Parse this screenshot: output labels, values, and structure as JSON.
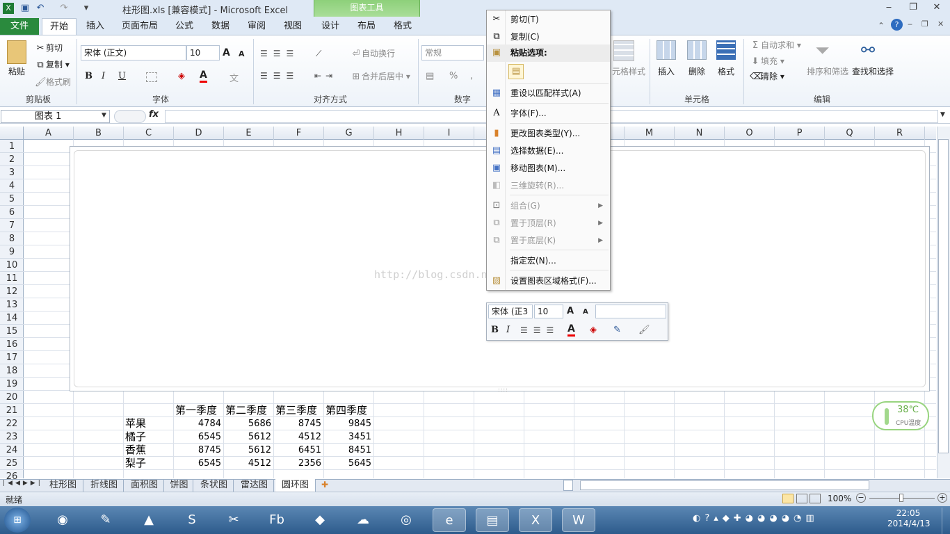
{
  "titlebar": {
    "title": "柱形图.xls  [兼容模式] - Microsoft Excel",
    "context_tools": "图表工具",
    "minimize": "‒",
    "restore": "❐",
    "close": "✕"
  },
  "tabs": [
    "文件",
    "开始",
    "插入",
    "页面布局",
    "公式",
    "数据",
    "审阅",
    "视图",
    "设计",
    "布局",
    "格式"
  ],
  "ribbon": {
    "clipboard": {
      "paste": "粘贴",
      "cut": "剪切",
      "copy": "复制",
      "format_painter": "格式刷",
      "label": "剪贴板"
    },
    "font": {
      "name": "宋体 (正文)",
      "size": "10",
      "bold": "B",
      "italic": "I",
      "underline": "U",
      "label": "字体",
      "grow": "A",
      "shrink": "A"
    },
    "alignment": {
      "wrap": "自动换行",
      "merge": "合并后居中",
      "label": "对齐方式"
    },
    "number": {
      "format": "常规",
      "percent": "%",
      "comma": ",",
      "label": "数字"
    },
    "styles": {
      "cell_styles": "元格样式"
    },
    "cells": {
      "insert": "插入",
      "delete": "删除",
      "format": "格式",
      "label": "单元格"
    },
    "editing": {
      "autosum": "自动求和",
      "fill": "填充",
      "clear": "清除",
      "sort": "排序和筛选",
      "find": "查找和选择",
      "label": "编辑"
    }
  },
  "formula_bar": {
    "name_box": "图表 1",
    "fx": "fx",
    "value": ""
  },
  "columns": [
    "A",
    "B",
    "C",
    "D",
    "E",
    "F",
    "G",
    "H",
    "I",
    "J",
    "K",
    "L",
    "M",
    "N",
    "O",
    "P",
    "Q",
    "R"
  ],
  "rows": [
    "1",
    "2",
    "3",
    "4",
    "5",
    "6",
    "7",
    "8",
    "9",
    "10",
    "11",
    "12",
    "13",
    "14",
    "15",
    "16",
    "17",
    "18",
    "19",
    "20",
    "21",
    "22",
    "23",
    "24",
    "25",
    "26"
  ],
  "table": {
    "headers": [
      "第一季度",
      "第二季度",
      "第三季度",
      "第四季度"
    ],
    "rows": [
      {
        "label": "苹果",
        "values": [
          "4784",
          "5686",
          "8745",
          "9845"
        ]
      },
      {
        "label": "橘子",
        "values": [
          "6545",
          "5612",
          "4512",
          "3451"
        ]
      },
      {
        "label": "香蕉",
        "values": [
          "8745",
          "5612",
          "6451",
          "8451"
        ]
      },
      {
        "label": "梨子",
        "values": [
          "6545",
          "4512",
          "2356",
          "5645"
        ]
      }
    ]
  },
  "watermark": "http://blog.csdn.net/xiaobai45",
  "context_menu": {
    "cut": "剪切(T)",
    "copy": "复制(C)",
    "paste_options": "粘贴选项:",
    "reset_style": "重设以匹配样式(A)",
    "font": "字体(F)...",
    "change_type": "更改图表类型(Y)...",
    "select_data": "选择数据(E)...",
    "move_chart": "移动图表(M)...",
    "rotate_3d": "三维旋转(R)...",
    "group": "组合(G)",
    "bring_front": "置于顶层(R)",
    "send_back": "置于底层(K)",
    "assign_macro": "指定宏(N)...",
    "format_area": "设置图表区域格式(F)..."
  },
  "mini_toolbar": {
    "font": "宋体 (正3",
    "size": "10",
    "bold": "B",
    "italic": "I"
  },
  "sheet_tabs": [
    "柱形图",
    "折线图",
    "面积图",
    "饼图",
    "条状图",
    "雷达图",
    "圆环图"
  ],
  "active_sheet": "圆环图",
  "status": {
    "ready": "就绪",
    "zoom": "100%"
  },
  "cpu": {
    "temp": "38℃",
    "label": "CPU温度"
  },
  "clock": {
    "time": "22:05",
    "date": "2014/4/13"
  }
}
